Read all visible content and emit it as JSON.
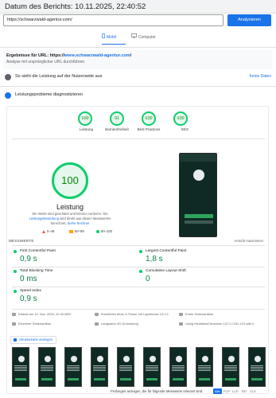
{
  "header": {
    "title": "Datum des Berichts: 10.11.2025, 22:40:52"
  },
  "search": {
    "url": "https://schwarzwald-agentur.com/",
    "analyze_label": "Analysieren"
  },
  "device_tabs": [
    {
      "label": "Mobil"
    },
    {
      "label": "Computer"
    }
  ],
  "result": {
    "prefix": "Ergebnisse für URL: https://",
    "link": "www.schwarzwald-agentur.com",
    "suffix": "/",
    "sub": "Analyse mit ursprünglicher URL durchführen"
  },
  "user_experience": {
    "label": "So sieht die Leistung auf der Nutzerseite aus",
    "status": "Keine Daten"
  },
  "diagnose": {
    "label": "Leistungsprobleme diagnostizieren"
  },
  "scores": [
    {
      "value": "100",
      "label": "Leistung"
    },
    {
      "value": "91",
      "label": "Barrierefreiheit"
    },
    {
      "value": "100",
      "label": "Best Practices"
    },
    {
      "value": "100",
      "label": "SEO"
    }
  ],
  "performance": {
    "score": "100",
    "label": "Leistung",
    "desc_1": "Die Werte sind geschätzt und können variieren. Die",
    "desc_link": "Leistungsbewertung",
    "desc_2": "wird direkt aus diesen Messwerten",
    "desc_3": "berechnet.",
    "desc_link2": "Siehe Rechner"
  },
  "legend": [
    {
      "label": "0–49",
      "color": "#ff4e42"
    },
    {
      "label": "50–89",
      "color": "#ffa400"
    },
    {
      "label": "90–100",
      "color": "#0cce6b"
    }
  ],
  "metrics_head": {
    "left": "MESSWERTE",
    "right": "Ansicht maximieren"
  },
  "metrics": [
    {
      "name": "First Contentful Paint",
      "value": "0,9 s"
    },
    {
      "name": "Largest Contentful Paint",
      "value": "1,8 s"
    },
    {
      "name": "Total Blocking Time",
      "value": "0 ms"
    },
    {
      "name": "Cumulative Layout Shift",
      "value": "0"
    },
    {
      "name": "Speed Index",
      "value": "0,9 s"
    }
  ],
  "meta": [
    "Erfasst am 10. Nov. 2025, 22:40 MEZ",
    "Emuliertes Moto G Power mit Lighthouse 13.0.1",
    "Einzelner Seitenaufbau",
    "Erster Seitenaufbau",
    "Langsame 4G-Drosselung",
    "Using HeadlessChromium 137.0.7151.119 with lr"
  ],
  "treemap": {
    "label": "Strukturkarte anzeigen"
  },
  "filter": {
    "label": "Prüfungen anzeigen, die für folgende Messwerte relevant sind:",
    "chips": [
      "Alle",
      "FCP",
      "LCP",
      "TBT",
      "CLS"
    ]
  },
  "colors": {
    "accent": "#1a73e8",
    "pass": "#0cce6b",
    "pass_text": "#008800"
  },
  "icons": [
    "phone-icon",
    "monitor-icon",
    "chevron-right-icon",
    "treemap-icon"
  ]
}
